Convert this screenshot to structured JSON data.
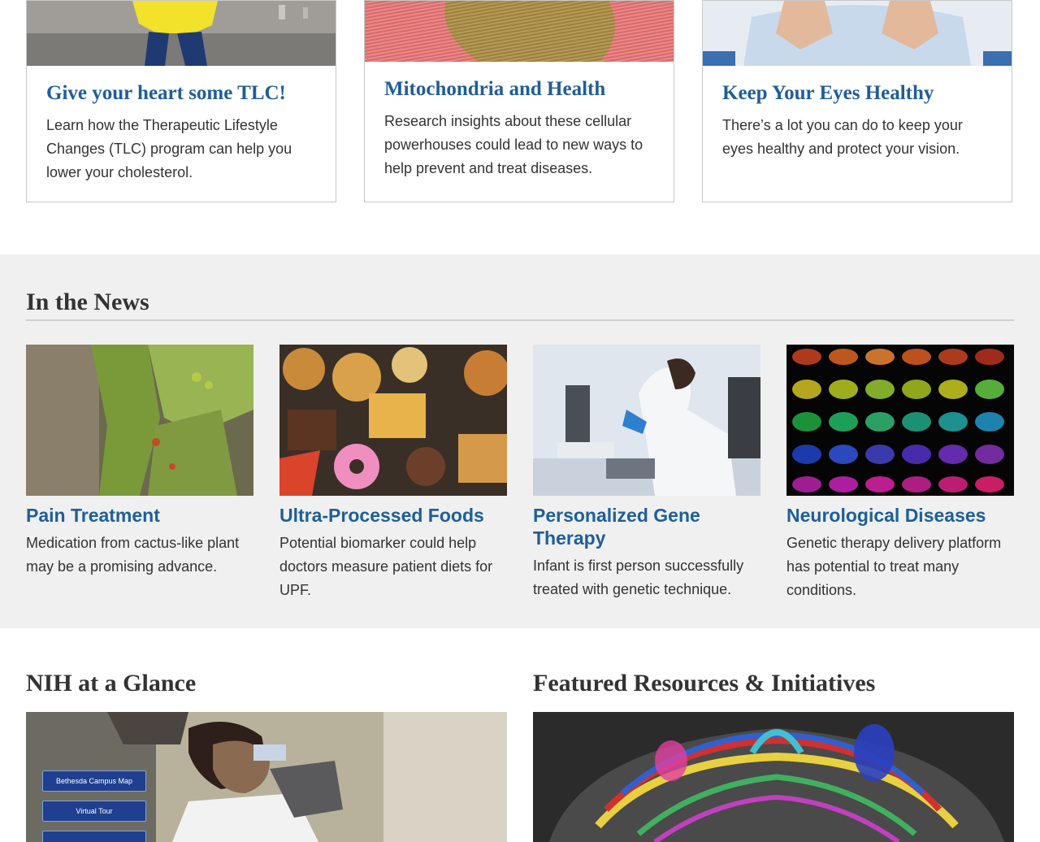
{
  "cards": [
    {
      "title": "Give your heart some TLC!",
      "desc": "Learn how the Therapeutic Lifestyle Changes (TLC) program can help you lower your cholesterol."
    },
    {
      "title": "Mitochondria and Health",
      "desc": "Research insights about these cellular powerhouses could lead to new ways to help prevent and treat diseases."
    },
    {
      "title": "Keep Your Eyes Healthy",
      "desc": "There’s a lot you can do to keep your eyes healthy and protect your vision."
    }
  ],
  "news": {
    "title": "In the News",
    "items": [
      {
        "title": "Pain Treatment",
        "desc": "Medication from cactus-like plant may be a promising advance."
      },
      {
        "title": "Ultra-Processed Foods",
        "desc": "Potential biomarker could help doctors measure patient diets for UPF."
      },
      {
        "title": "Personalized Gene Therapy",
        "desc": "Infant is first person successfully treated with genetic technique."
      },
      {
        "title": "Neurological Diseases",
        "desc": "Genetic therapy delivery platform has potential to treat many conditions."
      }
    ]
  },
  "glance": {
    "title": "NIH at a Glance",
    "buttons": [
      "Bethesda Campus Map",
      "Virtual Tour"
    ]
  },
  "featured": {
    "title": "Featured Resources & Initiatives"
  },
  "colors": {
    "link_blue": "#1f5e98",
    "section_bg": "#f0f0f0",
    "campus_button": "#1f3f8f"
  }
}
